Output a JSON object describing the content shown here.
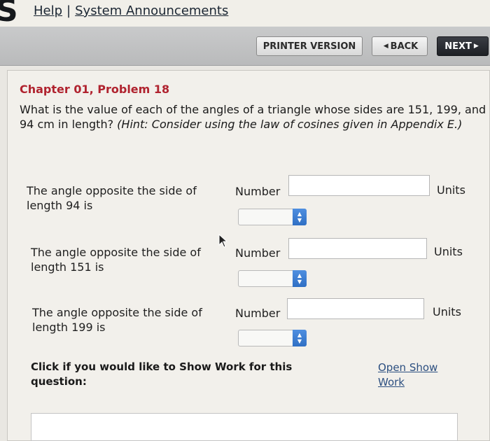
{
  "header": {
    "help_link": "Help",
    "separator": "|",
    "announcements_link": "System Announcements"
  },
  "toolbar": {
    "printer_label": "PRINTER VERSION",
    "back_label": "BACK",
    "next_label": "NEXT"
  },
  "problem": {
    "chapter_title": "Chapter 01, Problem 18",
    "question_text": "What is the value of each of the angles of a triangle whose sides are 151, 199, and 94 cm in length? ",
    "hint_text": "(Hint: Consider using the law of cosines given in Appendix E.)"
  },
  "answers": [
    {
      "label": "The angle opposite the side of length 94 is",
      "number_label": "Number",
      "value": "",
      "units_label": "Units",
      "unit_selected": ""
    },
    {
      "label": "The angle opposite the side of length 151 is",
      "number_label": "Number",
      "value": "",
      "units_label": "Units",
      "unit_selected": ""
    },
    {
      "label": "The angle opposite the side of length 199 is",
      "number_label": "Number",
      "value": "",
      "units_label": "Units",
      "unit_selected": ""
    }
  ],
  "show_work": {
    "prompt": "Click if you would like to Show Work for this question:",
    "link": "Open Show Work"
  },
  "colors": {
    "chapter_title": "#b0232f",
    "next_button_bg": "#1e2025",
    "link": "#2c4f80",
    "stepper": "#2f6fc4"
  }
}
